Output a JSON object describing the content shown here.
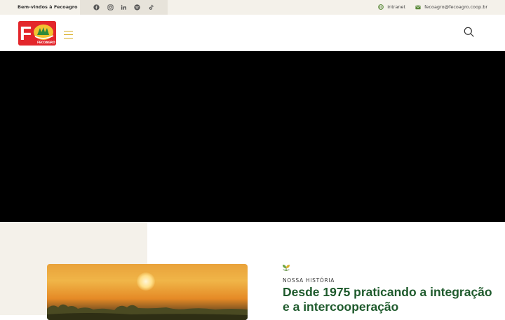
{
  "topbar": {
    "welcome": "Bem-vindos à Fecoagro",
    "social_icons": [
      "facebook-icon",
      "instagram-icon",
      "linkedin-icon",
      "spotify-icon",
      "tiktok-icon"
    ],
    "intranet_label": "Intranet",
    "email_label": "fecoagro@fecoagro.coop.br"
  },
  "header": {
    "logo_text": "FECOAGRO",
    "menu_icon": "hamburger-icon",
    "search_icon": "search-icon"
  },
  "section": {
    "eyebrow": "NOSSA HISTÓRIA",
    "headline": "Desde 1975 praticando a integração e a intercooperação"
  },
  "colors": {
    "brand_red": "#e3262b",
    "accent_gold": "#d9b02a",
    "heading_green": "#1e5a2c",
    "topbar_bg": "#f4f1ea"
  }
}
